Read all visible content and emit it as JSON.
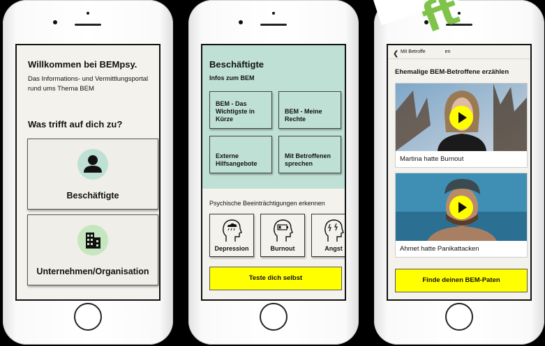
{
  "screen1": {
    "title": "Willkommen bei BEMpsy.",
    "subtitle": "Das Informations- und Vermittlungsportal rund ums Thema BEM",
    "question": "Was trifft auf dich zu?",
    "cards": [
      {
        "label": "Beschäftigte",
        "icon": "person-icon"
      },
      {
        "label": "Unternehmen/Organisation",
        "icon": "building-icon"
      }
    ]
  },
  "screen2": {
    "title": "Beschäftigte",
    "subtitle": "Infos zum BEM",
    "tiles": [
      {
        "label": "BEM - Das Wichtigste in Kürze"
      },
      {
        "label": "BEM - Meine Rechte"
      },
      {
        "label": "Externe Hilfsangebote"
      },
      {
        "label": "Mit Betroffenen sprechen"
      }
    ],
    "section_title": "Psychische Beeinträchtigungen erkennen",
    "symptoms": [
      {
        "label": "Depression",
        "icon": "head-cloud-icon"
      },
      {
        "label": "Burnout",
        "icon": "head-battery-icon"
      },
      {
        "label": "Angst",
        "icon": "head-lightning-icon"
      }
    ],
    "button": "Teste dich selbst"
  },
  "screen3": {
    "nav_back": "Mit Betroffe",
    "nav_back_tail": "en",
    "title": "Ehemalige BEM-Betroffene erzählen",
    "videos": [
      {
        "caption": "Martina hatte Burnout"
      },
      {
        "caption": "Ahmet hatte Panikattacken"
      }
    ],
    "button": "Finde deinen BEM-Paten"
  },
  "banner_text": "ft",
  "colors": {
    "mint": "#bfe0d4",
    "yellow": "#ffff00",
    "light_green": "#c6e6c0",
    "banner_green": "#7fc34a"
  }
}
